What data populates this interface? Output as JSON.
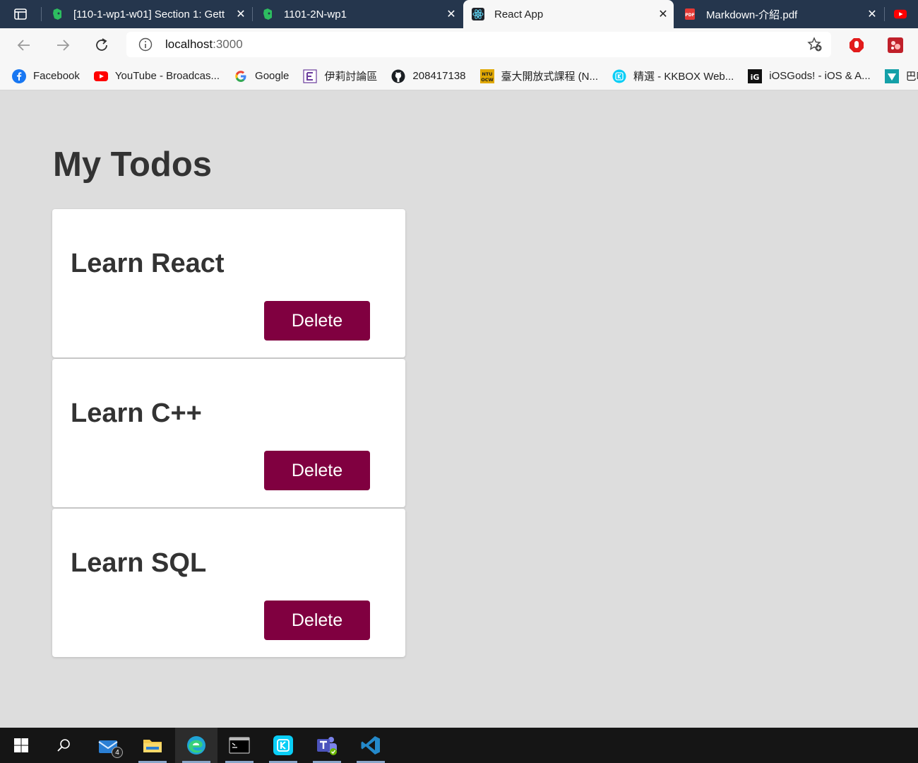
{
  "browser": {
    "tabs": [
      {
        "title": "[110-1-wp1-w01] Section 1: Gett",
        "icon": "evernote-icon",
        "active": false
      },
      {
        "title": "1101-2N-wp1",
        "icon": "evernote-icon",
        "active": false
      },
      {
        "title": "React App",
        "icon": "react-icon",
        "active": true
      },
      {
        "title": "Markdown-介紹.pdf",
        "icon": "pdf-icon",
        "active": false
      }
    ],
    "address": {
      "host": "localhost",
      "port": ":3000"
    },
    "bookmarks": [
      {
        "label": "Facebook",
        "icon": "facebook-icon"
      },
      {
        "label": "YouTube - Broadcas...",
        "icon": "youtube-icon"
      },
      {
        "label": "Google",
        "icon": "google-icon"
      },
      {
        "label": "伊莉討論區",
        "icon": "eyny-icon"
      },
      {
        "label": "208417138",
        "icon": "github-icon"
      },
      {
        "label": "臺大開放式課程 (N...",
        "icon": "ntu-ocw-icon"
      },
      {
        "label": "精選 - KKBOX Web...",
        "icon": "kkbox-icon"
      },
      {
        "label": "iOSGods! - iOS & A...",
        "icon": "iosgods-icon"
      },
      {
        "label": "巴哈姆特",
        "icon": "bahamut-icon"
      }
    ]
  },
  "app": {
    "title": "My Todos",
    "todos": [
      {
        "text": "Learn React",
        "button": "Delete"
      },
      {
        "text": "Learn C++",
        "button": "Delete"
      },
      {
        "text": "Learn SQL",
        "button": "Delete"
      }
    ]
  },
  "taskbar": {
    "mail_badge": "4"
  },
  "colors": {
    "delete_button": "#800040",
    "page_background": "#dddddd",
    "tabstrip": "#25364d"
  }
}
